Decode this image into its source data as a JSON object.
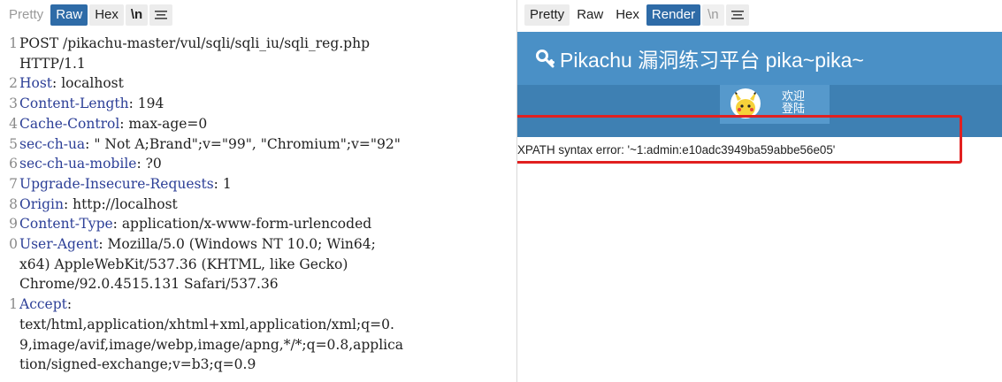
{
  "request": {
    "tabs": [
      "Pretty",
      "Raw",
      "Hex",
      "\\n"
    ],
    "lines": [
      {
        "num": "1",
        "parts": [
          [
            "v",
            "POST /pikachu-master/vul/sqli/sqli_iu/sqli_reg.php"
          ]
        ]
      },
      {
        "num": "",
        "parts": [
          [
            "v",
            "HTTP/1.1"
          ]
        ]
      },
      {
        "num": "2",
        "parts": [
          [
            "k",
            "Host"
          ],
          [
            "v",
            ": localhost"
          ]
        ]
      },
      {
        "num": "3",
        "parts": [
          [
            "k",
            "Content-Length"
          ],
          [
            "v",
            ": 194"
          ]
        ]
      },
      {
        "num": "4",
        "parts": [
          [
            "k",
            "Cache-Control"
          ],
          [
            "v",
            ": max-age=0"
          ]
        ]
      },
      {
        "num": "5",
        "parts": [
          [
            "k",
            "sec-ch-ua"
          ],
          [
            "v",
            ": \" Not A;Brand\";v=\"99\", \"Chromium\";v=\"92\""
          ]
        ]
      },
      {
        "num": "6",
        "parts": [
          [
            "k",
            "sec-ch-ua-mobile"
          ],
          [
            "v",
            ": ?0"
          ]
        ]
      },
      {
        "num": "7",
        "parts": [
          [
            "k",
            "Upgrade-Insecure-Requests"
          ],
          [
            "v",
            ": 1"
          ]
        ]
      },
      {
        "num": "8",
        "parts": [
          [
            "k",
            "Origin"
          ],
          [
            "v",
            ": http://localhost"
          ]
        ]
      },
      {
        "num": "9",
        "parts": [
          [
            "k",
            "Content-Type"
          ],
          [
            "v",
            ": application/x-www-form-urlencoded"
          ]
        ]
      },
      {
        "num": "0",
        "parts": [
          [
            "k",
            "User-Agent"
          ],
          [
            "v",
            ": Mozilla/5.0 (Windows NT 10.0; Win64;"
          ]
        ]
      },
      {
        "num": "",
        "parts": [
          [
            "v",
            "x64) AppleWebKit/537.36 (KHTML, like Gecko)"
          ]
        ]
      },
      {
        "num": "",
        "parts": [
          [
            "v",
            "Chrome/92.0.4515.131 Safari/537.36"
          ]
        ]
      },
      {
        "num": "1",
        "parts": [
          [
            "k",
            "Accept"
          ],
          [
            "v",
            ":"
          ]
        ]
      },
      {
        "num": "",
        "parts": [
          [
            "v",
            "text/html,application/xhtml+xml,application/xml;q=0."
          ]
        ]
      },
      {
        "num": "",
        "parts": [
          [
            "v",
            "9,image/avif,image/webp,image/apng,*/*;q=0.8,applica"
          ]
        ]
      },
      {
        "num": "",
        "parts": [
          [
            "v",
            "tion/signed-exchange;v=b3;q=0.9"
          ]
        ]
      }
    ]
  },
  "response": {
    "tabs": [
      "Pretty",
      "Raw",
      "Hex",
      "Render",
      "\\n"
    ],
    "banner_title": "Pikachu 漏洞练习平台 pika~pika~",
    "welcome": "欢迎 登陆",
    "error": "XPATH syntax error: '~1:admin:e10adc3949ba59abbe56e05'"
  },
  "colors": {
    "active_tab": "#2e6ba7",
    "banner": "#4a90c6",
    "navbar": "#3e80b3",
    "highlight": "#e12020",
    "header_key": "#2c3f97"
  }
}
